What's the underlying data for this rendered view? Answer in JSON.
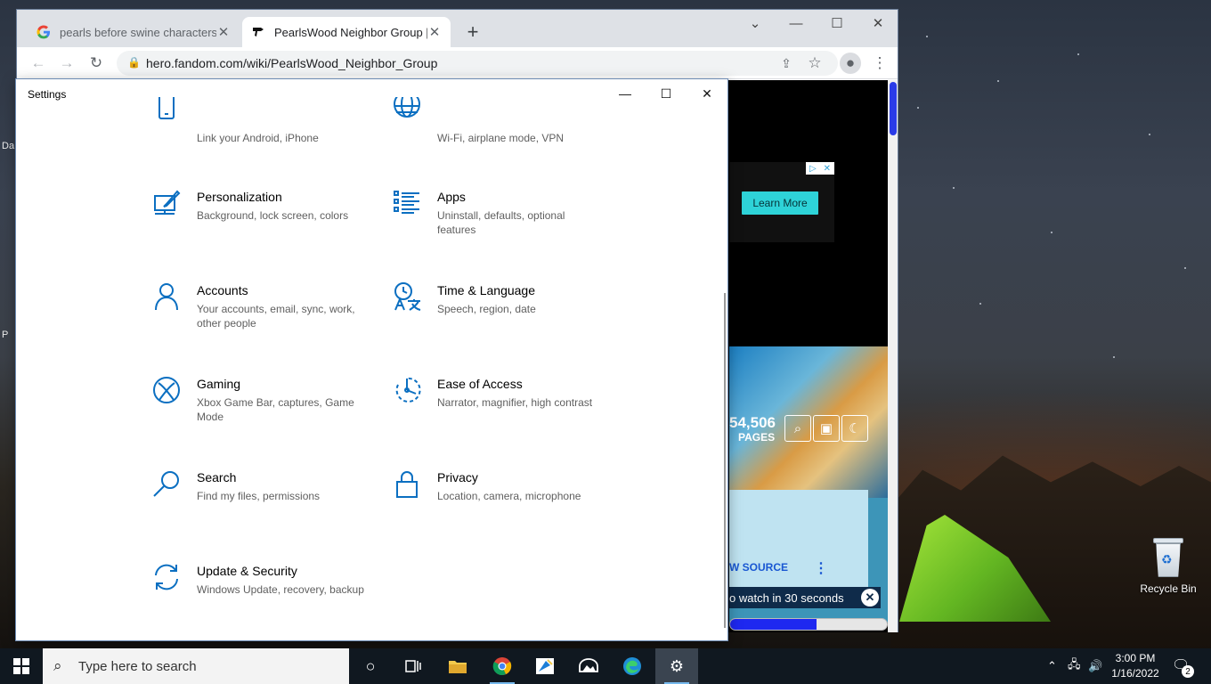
{
  "desktop": {
    "recycle_bin_label": "Recycle Bin",
    "left_peek": [
      "Da",
      "P"
    ]
  },
  "chrome": {
    "tabs": [
      {
        "title": "pearls before swine characters p",
        "favicon": "google-icon",
        "active": false
      },
      {
        "title": "PearlsWood Neighbor Group | H",
        "favicon": "fandom-icon",
        "active": true
      }
    ],
    "url": "hero.fandom.com/wiki/PearlsWood_Neighbor_Group",
    "page": {
      "ad_button": "Learn More",
      "pages_count": "54,506",
      "pages_label": "PAGES",
      "view_source": "W SOURCE",
      "watch_text": "o watch in 30 seconds",
      "video_progress": 0.55
    }
  },
  "settings": {
    "window_title": "Settings",
    "partial_tiles": [
      {
        "desc": "Link your Android, iPhone",
        "icon": "phone-icon"
      },
      {
        "desc": "Wi-Fi, airplane mode, VPN",
        "icon": "globe-icon"
      }
    ],
    "tiles": [
      {
        "name": "Personalization",
        "desc": "Background, lock screen, colors",
        "icon": "personalization-icon"
      },
      {
        "name": "Apps",
        "desc": "Uninstall, defaults, optional features",
        "icon": "apps-icon"
      },
      {
        "name": "Accounts",
        "desc": "Your accounts, email, sync, work, other people",
        "icon": "accounts-icon"
      },
      {
        "name": "Time & Language",
        "desc": "Speech, region, date",
        "icon": "time-language-icon"
      },
      {
        "name": "Gaming",
        "desc": "Xbox Game Bar, captures, Game Mode",
        "icon": "xbox-icon"
      },
      {
        "name": "Ease of Access",
        "desc": "Narrator, magnifier, high contrast",
        "icon": "ease-of-access-icon"
      },
      {
        "name": "Search",
        "desc": "Find my files, permissions",
        "icon": "search-icon"
      },
      {
        "name": "Privacy",
        "desc": "Location, camera, microphone",
        "icon": "lock-icon"
      },
      {
        "name": "Update & Security",
        "desc": "Windows Update, recovery, backup",
        "icon": "update-icon"
      }
    ]
  },
  "taskbar": {
    "search_placeholder": "Type here to search",
    "time": "3:00 PM",
    "date": "1/16/2022",
    "notification_count": "2"
  }
}
